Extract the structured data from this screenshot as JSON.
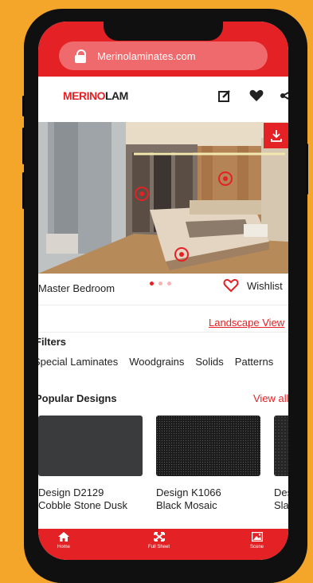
{
  "browser": {
    "url": "Merinolaminates.com"
  },
  "header": {
    "logo_red": "MERINO",
    "logo_dark": "LAM",
    "icons": [
      "edit-icon",
      "heart-icon",
      "share-icon"
    ]
  },
  "scene": {
    "name": "Master Bedroom",
    "wishlist_label": "Wishlist",
    "carousel_dots": 3,
    "active_dot": 0
  },
  "landscape_view": "Landscape View",
  "filters": {
    "title": "Filters",
    "options": [
      "Special Laminates",
      "Woodgrains",
      "Solids",
      "Patterns"
    ]
  },
  "popular": {
    "title": "Popular Designs",
    "view_all": "View all",
    "items": [
      {
        "code": "Design D2129",
        "name": "Cobble Stone Dusk",
        "color": "#3a3b3d"
      },
      {
        "code": "Design K1066",
        "name": "Black Mosaic",
        "color": "#1c1c1c"
      },
      {
        "code": "Design",
        "name": "Slate",
        "color": "#262626"
      }
    ]
  },
  "bottom_nav": [
    {
      "label": "Home",
      "icon": "home-icon"
    },
    {
      "label": "Full Sheet",
      "icon": "expand-icon"
    },
    {
      "label": "Scene",
      "icon": "image-icon"
    }
  ],
  "colors": {
    "brand": "#e42124",
    "background": "#f4a62a"
  }
}
